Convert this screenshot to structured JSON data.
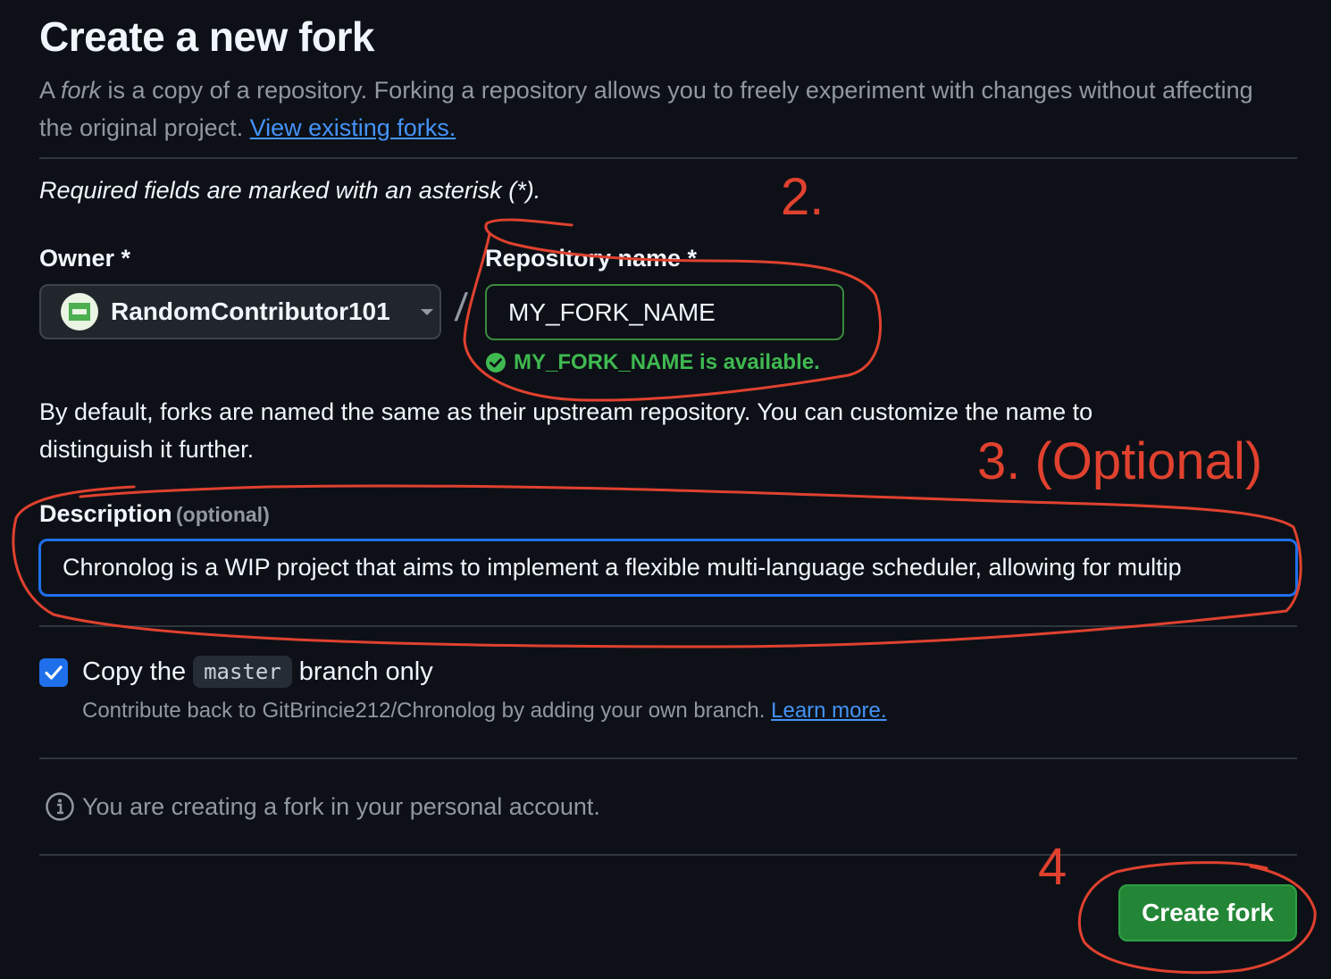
{
  "header": {
    "title": "Create a new fork",
    "intro_prefix": "A ",
    "intro_italic": "fork",
    "intro_suffix": " is a copy of a repository. Forking a repository allows you to freely experiment with changes without affecting the original project. ",
    "intro_link": "View existing forks."
  },
  "form": {
    "required_note": "Required fields are marked with an asterisk (*).",
    "owner": {
      "label": "Owner *",
      "value": "RandomContributor101"
    },
    "separator": "/",
    "repo": {
      "label": "Repository name *",
      "value": "MY_FORK_NAME",
      "available_msg": "MY_FORK_NAME is available."
    },
    "default_note": "By default, forks are named the same as their upstream repository. You can customize the name to distinguish it further.",
    "description": {
      "label": "Description",
      "optional": "(optional)",
      "value": "Chronolog is a WIP project that aims to implement a flexible multi-language scheduler, allowing for multip"
    },
    "copy_branch": {
      "checked": true,
      "label_prefix": "Copy the",
      "branch": "master",
      "label_suffix": "branch only",
      "help_text": "Contribute back to GitBrincie212/Chronolog by adding your own branch.",
      "help_link": "Learn more."
    },
    "info_text": "You are creating a fork in your personal account.",
    "submit_label": "Create fork"
  },
  "annotations": {
    "step2": "2.",
    "step3": "3. (Optional)",
    "step4": "4",
    "color": "#e0412f"
  },
  "colors": {
    "background": "#0d1117",
    "link": "#4493f8",
    "success": "#3fb950",
    "primary_button": "#238636",
    "focus_border": "#1f6feb"
  }
}
